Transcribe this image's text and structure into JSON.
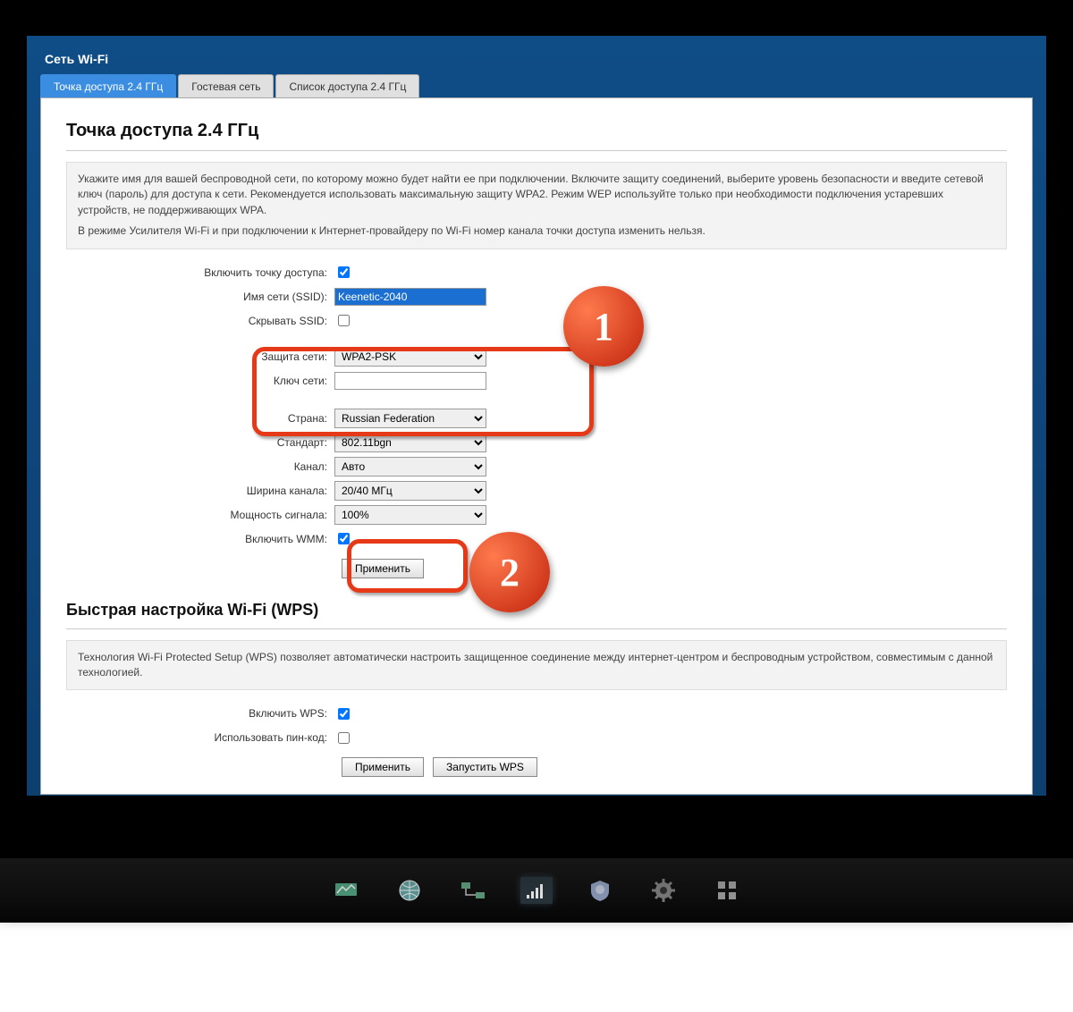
{
  "header": {
    "title": "Сеть Wi-Fi"
  },
  "tabs": [
    {
      "label": "Точка доступа 2.4 ГГц",
      "active": true
    },
    {
      "label": "Гостевая сеть",
      "active": false
    },
    {
      "label": "Список доступа 2.4 ГГц",
      "active": false
    }
  ],
  "ap": {
    "heading": "Точка доступа 2.4 ГГц",
    "desc1": "Укажите имя для вашей беспроводной сети, по которому можно будет найти ее при подключении. Включите защиту соединений, выберите уровень безопасности и введите сетевой ключ (пароль) для доступа к сети. Рекомендуется использовать максимальную защиту WPA2. Режим WEP используйте только при необходимости подключения устаревших устройств, не поддерживающих WPA.",
    "desc2": "В режиме Усилителя Wi-Fi и при подключении к Интернет-провайдеру по Wi-Fi номер канала точки доступа изменить нельзя.",
    "labels": {
      "enable_ap": "Включить точку доступа:",
      "ssid": "Имя сети (SSID):",
      "hide_ssid": "Скрывать SSID:",
      "security": "Защита сети:",
      "key": "Ключ сети:",
      "country": "Страна:",
      "standard": "Стандарт:",
      "channel": "Канал:",
      "width": "Ширина канала:",
      "power": "Мощность сигнала:",
      "wmm": "Включить WMM:"
    },
    "values": {
      "ssid": "Keenetic-2040",
      "security": "WPA2-PSK",
      "key": "",
      "country": "Russian Federation",
      "standard": "802.11bgn",
      "channel": "Авто",
      "width": "20/40 МГц",
      "power": "100%"
    },
    "apply": "Применить"
  },
  "wps": {
    "heading": "Быстрая настройка Wi-Fi (WPS)",
    "desc": "Технология Wi-Fi Protected Setup (WPS) позволяет автоматически настроить защищенное соединение между интернет-центром и беспроводным устройством, совместимым с данной технологией.",
    "labels": {
      "enable": "Включить WPS:",
      "use_pin": "Использовать пин-код:"
    },
    "apply": "Применить",
    "run": "Запустить WPS"
  },
  "annotations": {
    "badge1": "1",
    "badge2": "2"
  },
  "nav_icons": [
    "monitor-icon",
    "globe-icon",
    "network-icon",
    "wifi-icon",
    "shield-icon",
    "gear-icon",
    "apps-icon"
  ]
}
